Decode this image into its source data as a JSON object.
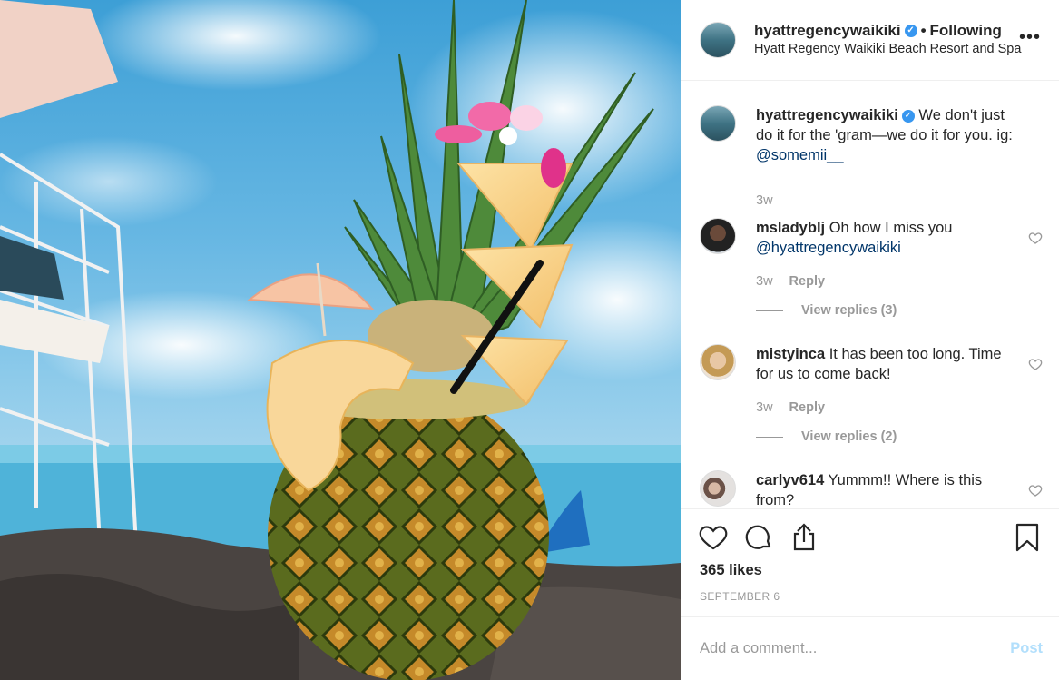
{
  "header": {
    "username": "hyattregencywaikiki",
    "separator": "•",
    "follow_status": "Following",
    "location": "Hyatt Regency Waikiki Beach Resort and Spa",
    "more_icon": "more-horizontal-icon"
  },
  "caption": {
    "username": "hyattregencywaikiki",
    "text": "We don't just do it for the 'gram—we do it for you. ig:",
    "mention": "@somemii__",
    "time": "3w"
  },
  "comments": [
    {
      "username": "msladyblj",
      "text": "Oh how I miss you",
      "mention": "@hyattregencywaikiki",
      "time": "3w",
      "reply_label": "Reply",
      "view_replies": "View replies (3)"
    },
    {
      "username": "mistyinca",
      "text": "It has been too long. Time for us to come back!",
      "time": "3w",
      "reply_label": "Reply",
      "view_replies": "View replies (2)"
    },
    {
      "username": "carlyv614",
      "text": "Yummm!! Where is this from?"
    }
  ],
  "actions": {
    "likes": "365 likes",
    "date": "SEPTEMBER 6",
    "icons": [
      "heart-icon",
      "comment-icon",
      "share-icon",
      "bookmark-icon"
    ]
  },
  "add_comment": {
    "placeholder": "Add a comment...",
    "post_label": "Post"
  },
  "colors": {
    "verified": "#3897f0",
    "mention": "#003569",
    "post_disabled": "#b2dffc",
    "muted": "#999999"
  }
}
